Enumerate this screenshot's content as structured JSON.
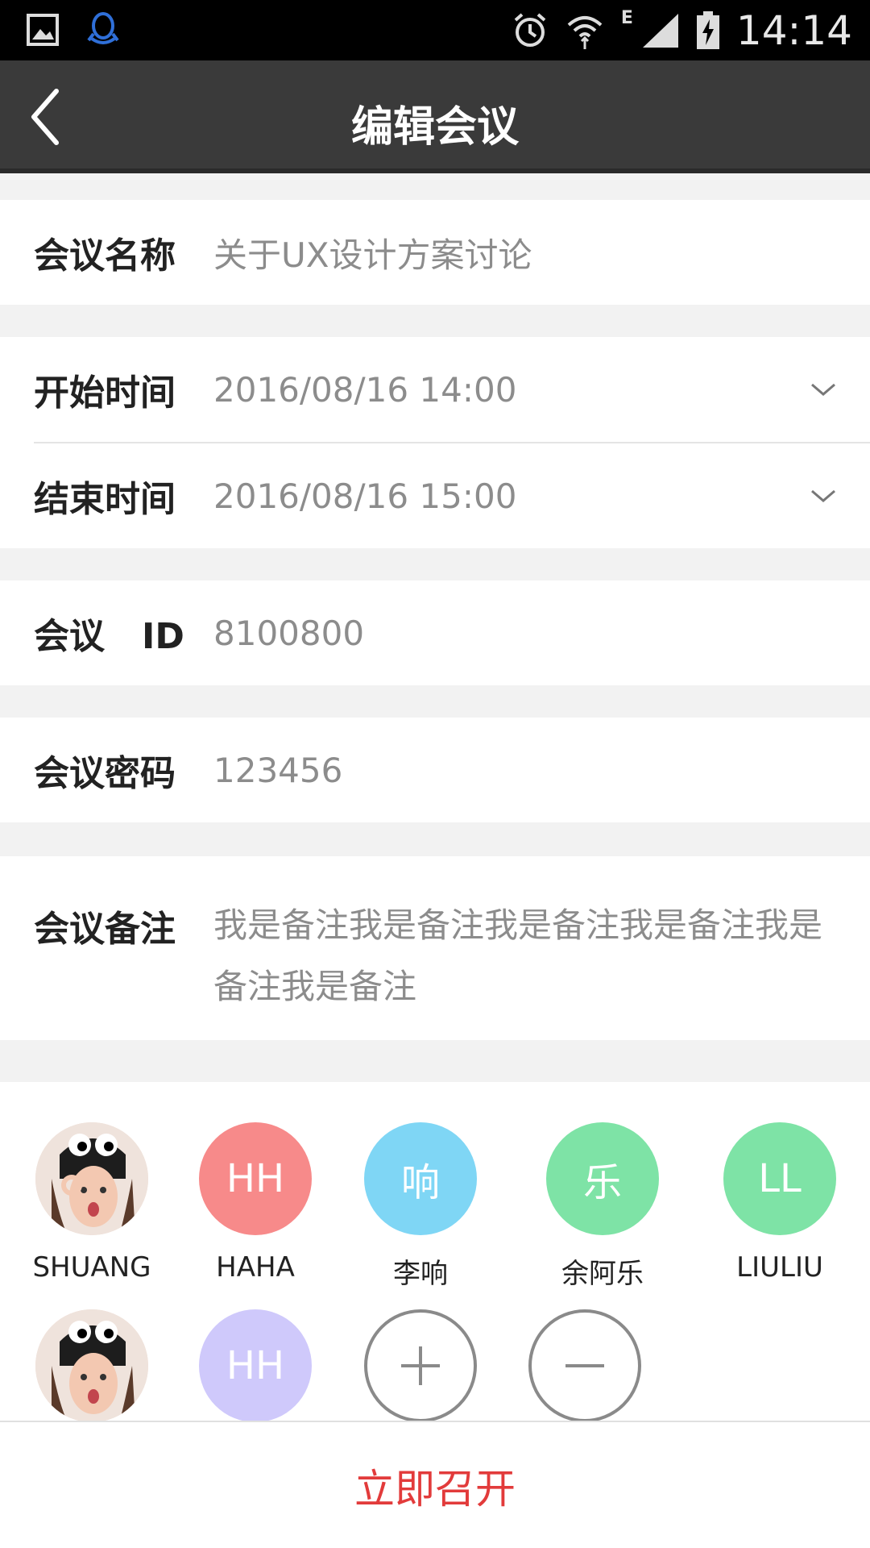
{
  "status_bar": {
    "time": "14:14",
    "network_type": "E",
    "icons": [
      "image-icon",
      "qq-icon",
      "alarm-icon",
      "wifi-icon",
      "signal-icon",
      "battery-charging-icon"
    ]
  },
  "header": {
    "title": "编辑会议",
    "back_icon": "back-icon"
  },
  "form": {
    "name": {
      "label": "会议名称",
      "value": "关于UX设计方案讨论"
    },
    "start": {
      "label": "开始时间",
      "value": "2016/08/16  14:00"
    },
    "end": {
      "label": "结束时间",
      "value": "2016/08/16  15:00"
    },
    "id": {
      "label": "会议   ID",
      "value": "8100800"
    },
    "password": {
      "label": "会议密码",
      "value": "123456"
    },
    "remark": {
      "label": "会议备注",
      "value": "我是备注我是备注我是备注我是备注我是备注我是备注"
    }
  },
  "participants": [
    {
      "name": "SHUANG",
      "initials": "",
      "color": "#f0d8cc",
      "photo": true
    },
    {
      "name": "HAHA",
      "initials": "HH",
      "color": "#f78a8a",
      "photo": false
    },
    {
      "name": "李响",
      "initials": "响",
      "color": "#7fd6f5",
      "photo": false
    },
    {
      "name": "余阿乐",
      "initials": "乐",
      "color": "#7ee3a6",
      "photo": false
    },
    {
      "name": "LIULIU",
      "initials": "LL",
      "color": "#7ee3a6",
      "photo": false
    },
    {
      "name": "",
      "initials": "",
      "color": "#f0d8cc",
      "photo": true
    },
    {
      "name": "",
      "initials": "HH",
      "color": "#cfc9fb",
      "photo": false
    }
  ],
  "actions": {
    "add_icon": "plus-icon",
    "remove_icon": "minus-icon",
    "start_label": "立即召开"
  },
  "colors": {
    "accent": "#e23b3b",
    "header_bg": "#3a3a3a"
  }
}
